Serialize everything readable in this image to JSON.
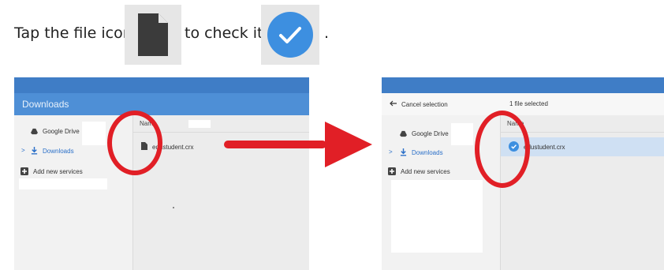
{
  "instruction": {
    "part1": "Tap the file icon",
    "part2": "to check it",
    "part3": "."
  },
  "left": {
    "title": "Downloads",
    "nav": [
      "Google Drive",
      "Downloads",
      "Add new services"
    ],
    "column_header": "Name",
    "file_name": "edustudent.crx"
  },
  "right": {
    "cancel_label": "Cancel selection",
    "selection_count": "1 file selected",
    "nav": [
      "Google Drive",
      "Downloads",
      "Add new services"
    ],
    "column_header": "Name",
    "file_name": "edustudent.crx"
  },
  "colors": {
    "blue_bar": "#4e8fd6",
    "highlight": "#e11f26",
    "check_blue": "#3d8fe0"
  }
}
